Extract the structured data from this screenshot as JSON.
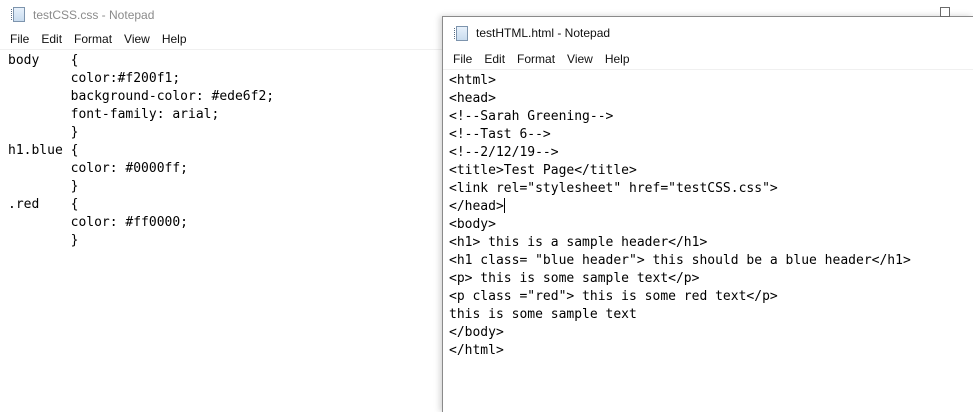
{
  "css_window": {
    "title": "testCSS.css - Notepad",
    "menu": [
      "File",
      "Edit",
      "Format",
      "View",
      "Help"
    ],
    "lines": [
      "body    {",
      "        color:#f200f1;",
      "        background-color: #ede6f2;",
      "        font-family: arial;",
      "        }",
      "h1.blue {",
      "        color: #0000ff;",
      "        }",
      ".red    {",
      "        color: #ff0000;",
      "        }"
    ]
  },
  "html_window": {
    "title": "testHTML.html - Notepad",
    "menu": [
      "File",
      "Edit",
      "Format",
      "View",
      "Help"
    ],
    "lines": [
      "<html>",
      "<head>",
      "<!--Sarah Greening-->",
      "<!--Tast 6-->",
      "<!--2/12/19-->",
      "<title>Test Page</title>",
      "<link rel=\"stylesheet\" href=\"testCSS.css\">",
      "</head>",
      "<body>",
      "<h1> this is a sample header</h1>",
      "<h1 class= \"blue header\"> this should be a blue header</h1>",
      "<p> this is some sample text</p>",
      "<p class =\"red\"> this is some red text</p>",
      "this is some sample text",
      "</body>",
      "</html>"
    ],
    "caret_line": 7
  },
  "icons": {
    "notepad": "notepad-document-icon",
    "maximize": "maximize-icon"
  },
  "colors": {
    "inactive_title": "#8b8b8b",
    "active_title": "#111111",
    "editor_text": "#000000",
    "background": "#ffffff"
  }
}
